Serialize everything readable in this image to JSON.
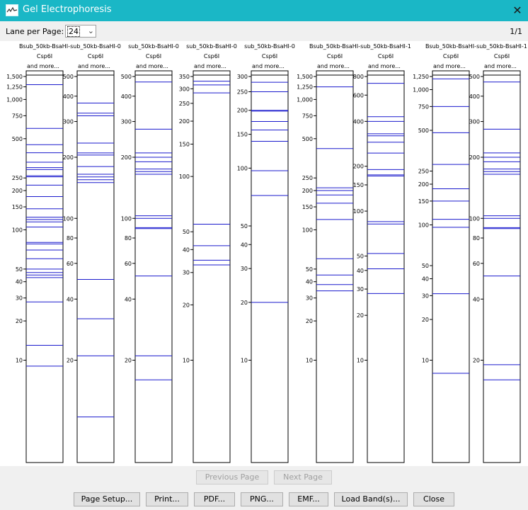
{
  "window": {
    "title": "Gel Electrophoresis",
    "close_glyph": "✕",
    "app_icon": "gel-app-icon"
  },
  "toolbar": {
    "lane_per_page_label": "Lane per Page:",
    "lane_per_page_value": "24",
    "page_indicator": "1/1"
  },
  "colors": {
    "titlebar": "#1ab7c6",
    "band": "#1a1acd",
    "marker": "#000000"
  },
  "nav": {
    "previous_label": "Previous Page",
    "next_label": "Next Page"
  },
  "buttons": {
    "page_setup": "Page Setup...",
    "print": "Print...",
    "pdf": "PDF...",
    "png": "PNG...",
    "emf": "EMF...",
    "load_bands": "Load Band(s)...",
    "close": "Close"
  },
  "lanes": [
    {
      "name": "Bsub_50kb-BsaHI-",
      "enzyme": "Csp6I",
      "extra": "and more...",
      "ticks": [
        "1,500",
        "1,250",
        "1,000",
        "750",
        "500",
        "250",
        "200",
        "150",
        "100",
        "50",
        "40",
        "30",
        "20",
        "10"
      ],
      "tick_values": [
        1500,
        1250,
        1000,
        750,
        500,
        250,
        200,
        150,
        100,
        50,
        40,
        30,
        20,
        10
      ],
      "bands": [
        1300,
        600,
        450,
        390,
        330,
        300,
        290,
        260,
        255,
        220,
        180,
        145,
        125,
        120,
        115,
        105,
        80,
        78,
        70,
        60,
        50,
        47,
        45,
        43,
        28,
        13,
        9
      ]
    },
    {
      "name": "sub_50kb-BsaHI-0",
      "enzyme": "Csp6I",
      "extra": "and more...",
      "ticks": [
        "500",
        "400",
        "300",
        "200",
        "100",
        "80",
        "60",
        "40",
        "20"
      ],
      "tick_values": [
        500,
        400,
        300,
        200,
        100,
        80,
        60,
        40,
        20
      ],
      "bands": [
        370,
        330,
        320,
        235,
        210,
        205,
        180,
        165,
        160,
        155,
        150,
        50,
        32,
        21,
        10.5
      ]
    },
    {
      "name": "sub_50kb-BsaHI-0",
      "enzyme": "Csp6I",
      "extra": "and more...",
      "ticks": [
        "500",
        "400",
        "300",
        "200",
        "100",
        "80",
        "60",
        "40",
        "20"
      ],
      "tick_values": [
        500,
        400,
        300,
        200,
        100,
        80,
        60,
        40,
        20
      ],
      "bands": [
        470,
        275,
        210,
        200,
        190,
        175,
        170,
        165,
        103,
        100,
        90,
        89,
        52,
        21,
        16
      ]
    },
    {
      "name": "sub_50kb-BsaHI-0",
      "enzyme": "Csp6I",
      "extra": "and more...",
      "ticks": [
        "350",
        "300",
        "250",
        "200",
        "150",
        "100",
        "50",
        "40",
        "30",
        "20",
        "10"
      ],
      "tick_values": [
        350,
        300,
        250,
        200,
        150,
        100,
        50,
        40,
        30,
        20,
        10
      ],
      "bands": [
        330,
        315,
        285,
        55,
        42,
        35,
        33
      ]
    },
    {
      "name": "sub_50kb-BsaHI-0",
      "enzyme": "Csp6I",
      "extra": "and more...",
      "ticks": [
        "300",
        "250",
        "200",
        "150",
        "100",
        "50",
        "40",
        "30",
        "20",
        "10"
      ],
      "tick_values": [
        300,
        250,
        200,
        150,
        100,
        50,
        40,
        30,
        20,
        10
      ],
      "bands": [
        280,
        250,
        200,
        198,
        175,
        158,
        138,
        97,
        72,
        20
      ]
    },
    {
      "name": "Bsub_50kb-BsaHI-",
      "enzyme": "Csp6I",
      "extra": "and more...",
      "ticks": [
        "1,500",
        "1,250",
        "1,000",
        "750",
        "500",
        "250",
        "200",
        "150",
        "100",
        "50",
        "40",
        "30",
        "20",
        "10"
      ],
      "tick_values": [
        1500,
        1250,
        1000,
        750,
        500,
        250,
        200,
        150,
        100,
        50,
        40,
        30,
        20,
        10
      ],
      "bands": [
        1250,
        420,
        210,
        200,
        185,
        160,
        120,
        60,
        45,
        38,
        34
      ]
    },
    {
      "name": "sub_50kb-BsaHI-1",
      "enzyme": "Csp6I",
      "extra": "and more...",
      "ticks": [
        "800",
        "600",
        "400",
        "200",
        "150",
        "100",
        "50",
        "40",
        "30",
        "20",
        "10"
      ],
      "tick_values": [
        800,
        600,
        400,
        200,
        150,
        100,
        50,
        40,
        30,
        20,
        10
      ],
      "bands": [
        720,
        430,
        400,
        330,
        320,
        290,
        245,
        190,
        175,
        172,
        85,
        82,
        52,
        41,
        28
      ]
    },
    {
      "name": "Bsub_50kb-BsaHI-",
      "enzyme": "Csp6I",
      "extra": "and more...",
      "ticks": [
        "1,250",
        "1,000",
        "750",
        "500",
        "250",
        "200",
        "150",
        "100",
        "50",
        "40",
        "30",
        "20",
        "10"
      ],
      "tick_values": [
        1250,
        1000,
        750,
        500,
        250,
        200,
        150,
        100,
        50,
        40,
        30,
        20,
        10
      ],
      "bands": [
        1200,
        750,
        480,
        280,
        185,
        150,
        110,
        96,
        31,
        8
      ]
    },
    {
      "name": "sub_50kb-BsaHI-1",
      "enzyme": "Csp6I",
      "extra": "and more...",
      "ticks": [
        "500",
        "400",
        "300",
        "200",
        "100",
        "80",
        "60",
        "40",
        "20"
      ],
      "tick_values": [
        500,
        400,
        300,
        200,
        100,
        80,
        60,
        40,
        20
      ],
      "bands": [
        470,
        275,
        210,
        200,
        190,
        175,
        170,
        165,
        103,
        100,
        90,
        89,
        52,
        19,
        16
      ]
    }
  ]
}
